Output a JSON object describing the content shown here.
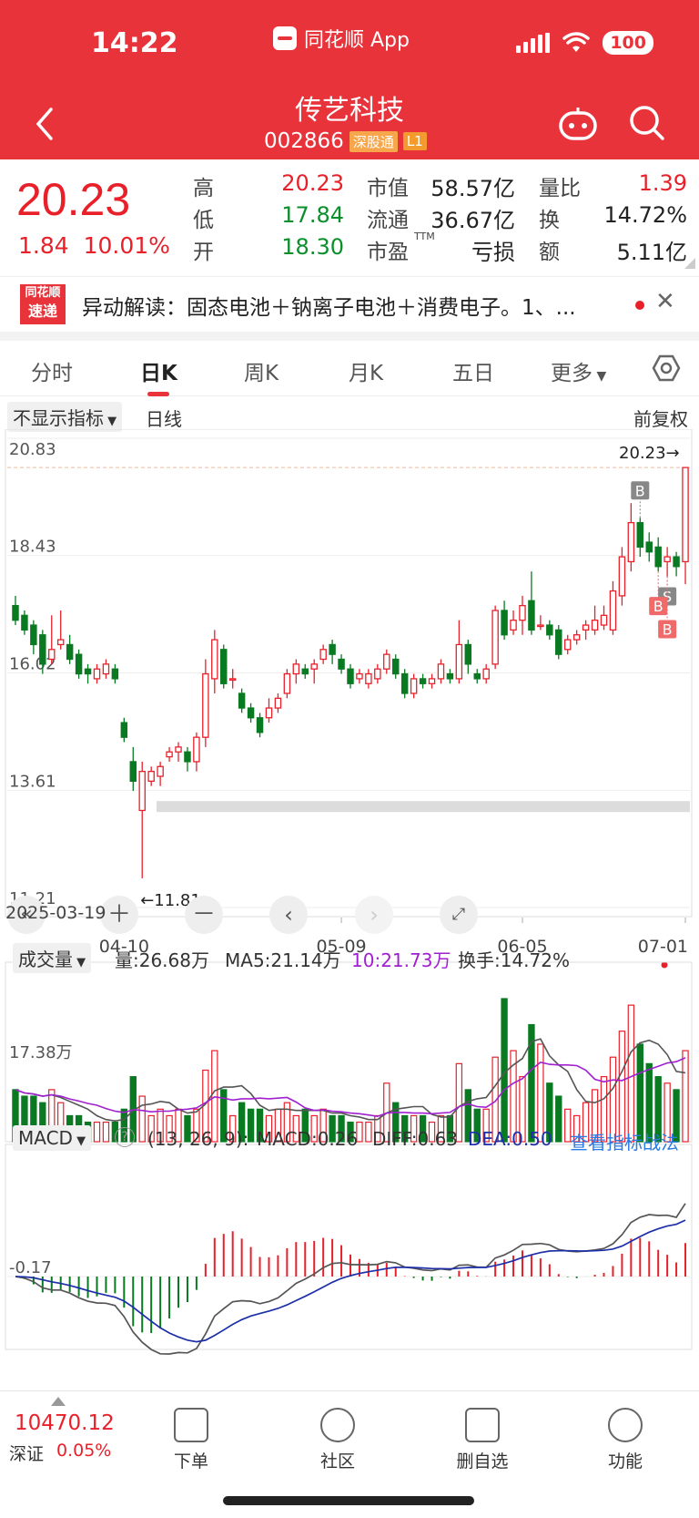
{
  "status_bar": {
    "time": "14:22",
    "app_name": "同花顺 App",
    "battery": "100"
  },
  "stock": {
    "name": "传艺科技",
    "code": "002866",
    "tag1": "深股通",
    "tag2": "L1"
  },
  "quote": {
    "price": "20.23",
    "change": "1.84",
    "change_pct": "10.01%",
    "fields": [
      {
        "label": "高",
        "value": "20.23",
        "color": "red"
      },
      {
        "label": "低",
        "value": "17.84",
        "color": "green"
      },
      {
        "label": "开",
        "value": "18.30",
        "color": "green"
      },
      {
        "label": "市值",
        "value": "58.57亿",
        "color": "black"
      },
      {
        "label": "流通",
        "value": "36.67亿",
        "color": "black"
      },
      {
        "label": "市盈",
        "value": "亏损",
        "color": "black"
      },
      {
        "label": "量比",
        "value": "1.39",
        "color": "red"
      },
      {
        "label": "换",
        "value": "14.72%",
        "color": "black"
      },
      {
        "label": "额",
        "value": "5.11亿",
        "color": "black"
      }
    ],
    "pe_suffix": "TTM"
  },
  "notice": {
    "logo_top": "同花顺",
    "logo_bottom": "速递",
    "text": "异动解读：固态电池＋钠离子电池＋消费电子。1、..."
  },
  "tabs": [
    "分时",
    "日K",
    "周K",
    "月K",
    "五日",
    "更多"
  ],
  "kline": {
    "indicator_select": "不显示指标",
    "line_type": "日线",
    "adjust": "前复权",
    "y_labels": [
      "20.83",
      "18.43",
      "16.02",
      "13.61",
      "11.21"
    ],
    "high_label": "20.23→",
    "low_label": "←11.81",
    "dates": [
      "2025-03-19",
      "04-10",
      "05-09",
      "06-05",
      "07-01"
    ],
    "markers": [
      "B",
      "S",
      "B",
      "B"
    ]
  },
  "volume": {
    "select": "成交量",
    "vol": "量:26.68万",
    "ma5": "MA5:21.14万",
    "ma10": "10:21.73万",
    "turnover": "换手:14.72%",
    "axis_label": "17.38万"
  },
  "macd": {
    "select": "MACD",
    "params": "(13, 26, 9):",
    "macd": "MACD:0.26",
    "diff": "DIFF:0.63",
    "dea": "DEA:0.50",
    "link": "查看指标战法",
    "axis_label": "-0.17"
  },
  "chart_data": {
    "type": "candlestick",
    "ylim": [
      11.21,
      20.83
    ],
    "candles": [
      [
        17.4,
        17.1,
        17.6,
        17.0
      ],
      [
        17.2,
        16.9,
        17.3,
        16.8
      ],
      [
        17.0,
        16.6,
        17.1,
        16.4
      ],
      [
        16.8,
        16.2,
        16.9,
        16.0
      ],
      [
        16.3,
        16.5,
        17.2,
        16.2
      ],
      [
        16.6,
        16.7,
        17.3,
        16.5
      ],
      [
        16.6,
        16.3,
        16.8,
        16.2
      ],
      [
        16.4,
        16.0,
        16.5,
        15.9
      ],
      [
        16.1,
        16.0,
        16.2,
        15.8
      ],
      [
        15.9,
        16.1,
        16.2,
        15.8
      ],
      [
        16.0,
        16.2,
        16.3,
        15.9
      ],
      [
        16.1,
        15.9,
        16.2,
        15.8
      ],
      [
        15.0,
        14.7,
        15.1,
        14.6
      ],
      [
        14.2,
        13.8,
        14.5,
        13.6
      ],
      [
        13.2,
        14.0,
        14.2,
        11.81
      ],
      [
        13.8,
        14.0,
        14.1,
        13.7
      ],
      [
        13.9,
        14.1,
        14.2,
        13.7
      ],
      [
        14.3,
        14.4,
        14.5,
        14.2
      ],
      [
        14.4,
        14.5,
        14.6,
        14.2
      ],
      [
        14.4,
        14.2,
        14.5,
        14.0
      ],
      [
        14.2,
        14.7,
        14.8,
        14.0
      ],
      [
        14.7,
        16.0,
        16.3,
        14.5
      ],
      [
        15.9,
        16.7,
        16.9,
        15.6
      ],
      [
        16.5,
        15.8,
        16.6,
        15.7
      ],
      [
        15.9,
        15.9,
        16.1,
        15.7
      ],
      [
        15.6,
        15.3,
        15.7,
        15.2
      ],
      [
        15.3,
        15.1,
        15.4,
        15.0
      ],
      [
        15.1,
        14.8,
        15.2,
        14.7
      ],
      [
        15.1,
        15.3,
        15.5,
        15.0
      ],
      [
        15.3,
        15.5,
        15.6,
        15.2
      ],
      [
        15.6,
        16.0,
        16.1,
        15.5
      ],
      [
        16.0,
        16.2,
        16.3,
        15.8
      ],
      [
        16.1,
        16.0,
        16.2,
        15.9
      ],
      [
        16.1,
        16.2,
        16.3,
        15.8
      ],
      [
        16.3,
        16.5,
        16.6,
        16.2
      ],
      [
        16.6,
        16.4,
        16.7,
        16.2
      ],
      [
        16.3,
        16.1,
        16.4,
        16.0
      ],
      [
        16.1,
        15.8,
        16.2,
        15.7
      ],
      [
        15.9,
        16.0,
        16.1,
        15.8
      ],
      [
        15.8,
        16.0,
        16.1,
        15.7
      ],
      [
        15.9,
        16.1,
        16.2,
        15.8
      ],
      [
        16.1,
        16.4,
        16.5,
        16.0
      ],
      [
        16.3,
        16.0,
        16.4,
        15.9
      ],
      [
        16.0,
        15.6,
        16.1,
        15.5
      ],
      [
        15.6,
        15.9,
        16.0,
        15.5
      ],
      [
        15.9,
        15.8,
        16.0,
        15.7
      ],
      [
        15.8,
        15.9,
        16.0,
        15.7
      ],
      [
        15.9,
        16.2,
        16.3,
        15.8
      ],
      [
        16.0,
        15.9,
        16.1,
        15.8
      ],
      [
        15.9,
        16.6,
        17.1,
        15.8
      ],
      [
        16.6,
        16.2,
        16.7,
        16.0
      ],
      [
        16.0,
        15.9,
        16.1,
        15.8
      ],
      [
        15.9,
        16.1,
        16.2,
        15.8
      ],
      [
        16.2,
        17.3,
        17.4,
        16.1
      ],
      [
        17.3,
        16.8,
        17.5,
        16.7
      ],
      [
        16.9,
        17.1,
        17.3,
        16.8
      ],
      [
        17.1,
        17.4,
        17.6,
        16.8
      ],
      [
        17.5,
        16.9,
        18.1,
        16.8
      ],
      [
        17.0,
        17.0,
        17.2,
        16.9
      ],
      [
        17.0,
        16.8,
        17.1,
        16.7
      ],
      [
        16.9,
        16.4,
        17.0,
        16.3
      ],
      [
        16.5,
        16.7,
        16.8,
        16.4
      ],
      [
        16.7,
        16.8,
        16.9,
        16.6
      ],
      [
        16.9,
        17.0,
        17.1,
        16.7
      ],
      [
        16.9,
        17.1,
        17.4,
        16.8
      ],
      [
        17.0,
        17.2,
        17.4,
        16.9
      ],
      [
        16.9,
        17.7,
        17.9,
        16.8
      ],
      [
        17.6,
        18.4,
        18.6,
        17.4
      ],
      [
        18.3,
        19.1,
        19.5,
        18.1
      ],
      [
        19.1,
        18.6,
        19.2,
        18.4
      ],
      [
        18.7,
        18.5,
        18.9,
        18.3
      ],
      [
        18.6,
        18.2,
        18.8,
        18.1
      ],
      [
        18.3,
        18.4,
        18.6,
        18.0
      ],
      [
        18.4,
        18.2,
        18.5,
        18.0
      ],
      [
        18.3,
        20.23,
        20.23,
        17.84
      ]
    ],
    "volume": [
      8,
      7,
      7,
      6,
      8,
      6,
      4,
      4,
      3,
      3,
      3,
      3,
      5,
      10,
      7,
      4,
      5,
      4,
      5,
      4,
      5,
      11,
      14,
      8,
      4,
      6,
      5,
      5,
      4,
      5,
      6,
      4,
      5,
      4,
      5,
      4,
      4,
      3,
      3,
      3,
      4,
      9,
      6,
      4,
      4,
      4,
      3,
      4,
      4,
      12,
      8,
      5,
      5,
      13,
      22,
      14,
      10,
      18,
      15,
      9,
      7,
      5,
      4,
      6,
      8,
      10,
      13,
      17,
      21,
      15,
      12,
      10,
      9,
      8,
      14
    ],
    "volume_ylim": [
      0,
      22
    ]
  }
}
